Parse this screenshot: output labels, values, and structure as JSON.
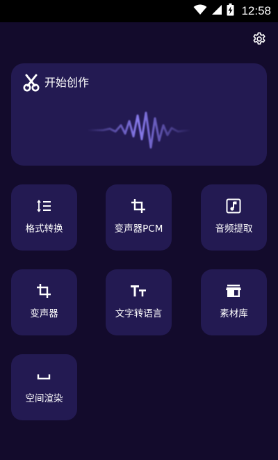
{
  "status_bar": {
    "time": "12:58",
    "icons": [
      "wifi-icon",
      "cell-signal-icon",
      "battery-charging-icon"
    ]
  },
  "header": {
    "settings_icon": "gear-icon"
  },
  "hero": {
    "title": "开始创作",
    "icon": "scissors-icon",
    "illustration": "sound-wave-icon"
  },
  "tools": [
    {
      "label": "格式转换",
      "icon": "format-list-numbered-icon"
    },
    {
      "label": "变声器PCM",
      "icon": "crop-icon"
    },
    {
      "label": "音频提取",
      "icon": "music-note-icon"
    },
    {
      "label": "变声器",
      "icon": "crop-icon"
    },
    {
      "label": "文字转语言",
      "icon": "text-size-icon"
    },
    {
      "label": "素材库",
      "icon": "store-icon"
    },
    {
      "label": "空间渲染",
      "icon": "space-bar-icon"
    }
  ],
  "colors": {
    "background": "#130b2c",
    "card": "#231a52",
    "wave": "#8a7cf0",
    "status_bar": "#000000"
  }
}
